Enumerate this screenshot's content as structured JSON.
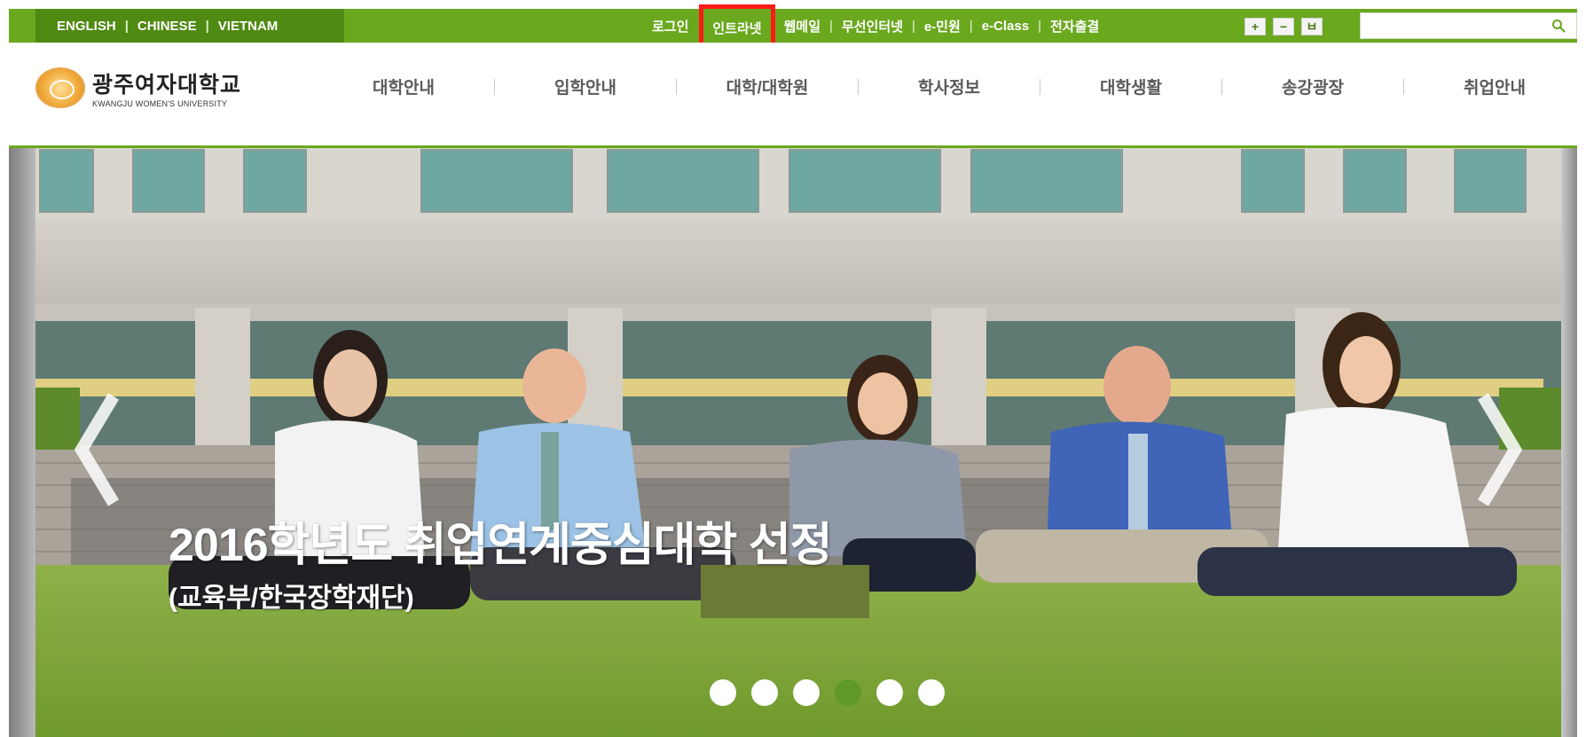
{
  "language_links": [
    "ENGLISH",
    "CHINESE",
    "VIETNAM"
  ],
  "language_separator": "|",
  "top_links": {
    "login": "로그인",
    "intranet": "인트라넷",
    "webmail": "웹메일",
    "wifi": "무선인터넷",
    "e_minwon": "e-민원",
    "e_class": "e-Class",
    "e_attendance": "전자출결"
  },
  "top_separator": "|",
  "tools": {
    "zoom_in": "+",
    "zoom_out": "−",
    "reset": "ㅂ"
  },
  "search": {
    "placeholder": ""
  },
  "logo": {
    "name_ko": "광주여자대학교",
    "name_en": "KWANGJU WOMEN'S UNIVERSITY"
  },
  "nav": {
    "items": [
      "대학안내",
      "입학안내",
      "대학/대학원",
      "학사정보",
      "대학생활",
      "송강광장",
      "취업안내"
    ]
  },
  "hero": {
    "title": "2016학년도 취업연계중심대학 선정",
    "subtitle": "(교육부/한국장학재단)",
    "slides_total": 6,
    "active_slide": 4
  },
  "colors": {
    "brand_green": "#6aa81e",
    "dark_green": "#4f8a12",
    "highlight_red": "#ff1a1a",
    "active_dot": "#5f9a26"
  }
}
